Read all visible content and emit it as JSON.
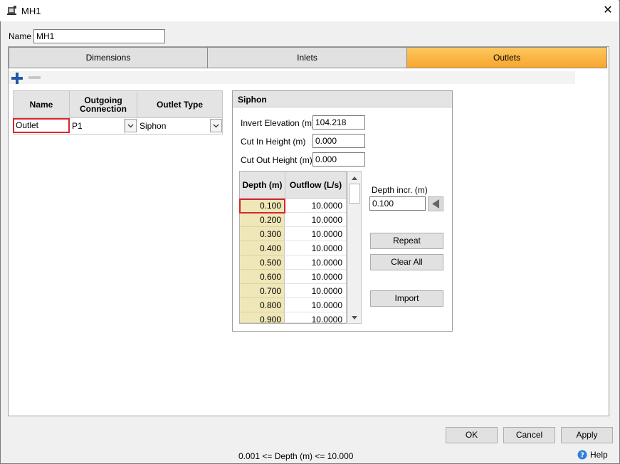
{
  "window": {
    "title": "MH1",
    "close_glyph": "✕"
  },
  "name_field": {
    "label": "Name",
    "value": "MH1"
  },
  "tabs": [
    {
      "label": "Dimensions",
      "active": false
    },
    {
      "label": "Inlets",
      "active": false
    },
    {
      "label": "Outlets",
      "active": true
    }
  ],
  "outlet_grid": {
    "headers": [
      "Name",
      "Outgoing Connection",
      "Outlet Type"
    ],
    "rows": [
      {
        "name": "Outlet",
        "connection": "P1",
        "type": "Siphon"
      }
    ]
  },
  "siphon": {
    "title": "Siphon",
    "invert_elevation": {
      "label": "Invert Elevation (m)",
      "value": "104.218"
    },
    "cut_in_height": {
      "label": "Cut In Height (m)",
      "value": "0.000"
    },
    "cut_out_height": {
      "label": "Cut Out Height (m)",
      "value": "0.000"
    },
    "table": {
      "headers": [
        "Depth (m)",
        "Outflow (L/s)"
      ],
      "rows": [
        [
          "0.100",
          "10.0000"
        ],
        [
          "0.200",
          "10.0000"
        ],
        [
          "0.300",
          "10.0000"
        ],
        [
          "0.400",
          "10.0000"
        ],
        [
          "0.500",
          "10.0000"
        ],
        [
          "0.600",
          "10.0000"
        ],
        [
          "0.700",
          "10.0000"
        ],
        [
          "0.800",
          "10.0000"
        ],
        [
          "0.900",
          "10.0000"
        ]
      ]
    },
    "depth_incr": {
      "label": "Depth incr. (m)",
      "value": "0.100"
    },
    "repeat_label": "Repeat",
    "clear_all_label": "Clear All",
    "import_label": "Import"
  },
  "footer": {
    "ok_label": "OK",
    "cancel_label": "Cancel",
    "apply_label": "Apply",
    "status": "0.001 <= Depth (m) <= 10.000",
    "help_label": "Help"
  },
  "colors": {
    "active_tab": "#f9a62f",
    "depth_cell": "#efe7b8",
    "selected_border": "#d9262c",
    "accent_blue": "#1f5aa6"
  }
}
